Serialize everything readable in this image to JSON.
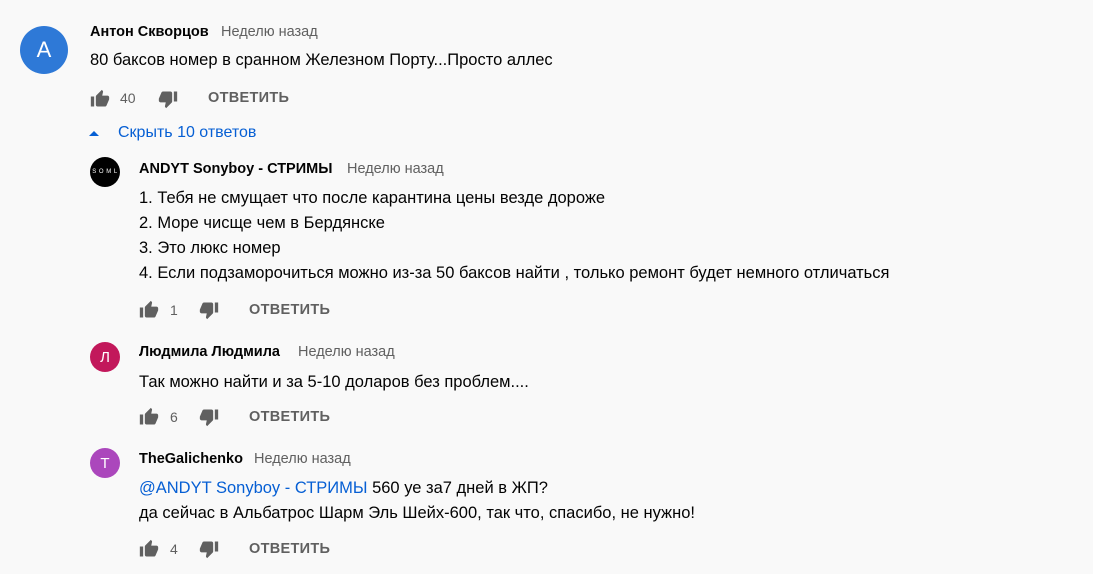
{
  "comment": {
    "avatar_letter": "А",
    "avatar_color": "#2e79d7",
    "author": "Антон Скворцов",
    "time": "Неделю назад",
    "text": "80 баксов номер в сранном Железном Порту...Просто аллес",
    "likes": "40",
    "reply_label": "ОТВЕТИТЬ"
  },
  "replies_toggle": {
    "label": "Скрыть 10 ответов",
    "icon": "caret-up-icon"
  },
  "replies": [
    {
      "avatar_text": "S O M L",
      "avatar_color": "#000000",
      "author": "ANDYT Sonyboy - СТРИМЫ",
      "time": "Неделю назад",
      "lines": [
        "1. Тебя не смущает что после карантина цены везде дороже",
        "2. Море чисще чем в Бердянске",
        "3. Это люкс номер",
        "4. Если подзаморочиться можно из-за 50 баксов найти , только ремонт будет немного отличаться"
      ],
      "likes": "1",
      "reply_label": "ОТВЕТИТЬ"
    },
    {
      "avatar_letter": "Л",
      "avatar_color": "#c2185b",
      "author": "Людмила Людмила",
      "time": "Неделю назад",
      "lines": [
        "Так можно найти и за 5-10 доларов без проблем...."
      ],
      "likes": "6",
      "reply_label": "ОТВЕТИТЬ"
    },
    {
      "avatar_letter": "T",
      "avatar_color": "#ab47bc",
      "author": "TheGalichenko",
      "time": "Неделю назад",
      "mention": "@ANDYT Sonyboy - СТРИМЫ",
      "lines": [
        " 560 уе за7 дней в  ЖП?",
        "да сейчас в Альбатрос Шарм Эль Шейх-600, так что, спасибо, не нужно!"
      ],
      "likes": "4",
      "reply_label": "ОТВЕТИТЬ"
    }
  ],
  "colors": {
    "link": "#065fd4",
    "secondary": "#606060",
    "text": "#030303"
  }
}
